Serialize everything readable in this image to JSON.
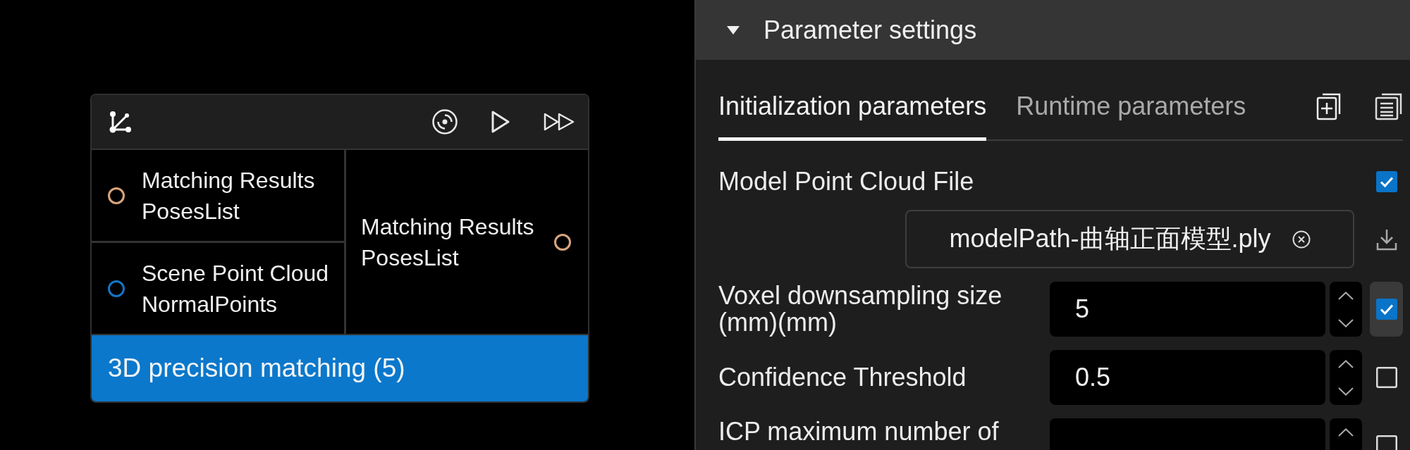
{
  "canvas": {
    "node": {
      "inputs": [
        {
          "name": "Matching Results",
          "type": "PosesList",
          "color": "#d9a57c"
        },
        {
          "name": "Scene Point Cloud",
          "type": "NormalPoints",
          "color": "#1474c4"
        }
      ],
      "outputs": [
        {
          "name": "Matching Results",
          "type": "PosesList",
          "color": "#d9a57c"
        }
      ],
      "title": "3D precision matching (5)"
    }
  },
  "panel": {
    "header": {
      "title": "Parameter settings",
      "expanded": true
    },
    "tabs": [
      {
        "label": "Initialization parameters",
        "selected": true
      },
      {
        "label": "Runtime parameters",
        "selected": false
      }
    ],
    "params": [
      {
        "kind": "file",
        "label": "Model Point Cloud File",
        "checked": true,
        "value": "modelPath-曲轴正面模型.ply"
      },
      {
        "kind": "number",
        "label": "Voxel downsampling size (mm)(mm)",
        "value": "5",
        "checked": true,
        "hovered": true
      },
      {
        "kind": "number",
        "label": "Confidence Threshold",
        "value": "0.5",
        "checked": false,
        "hovered": false
      },
      {
        "kind": "number",
        "label": "ICP maximum number of",
        "checked": false,
        "hovered": false
      }
    ]
  }
}
